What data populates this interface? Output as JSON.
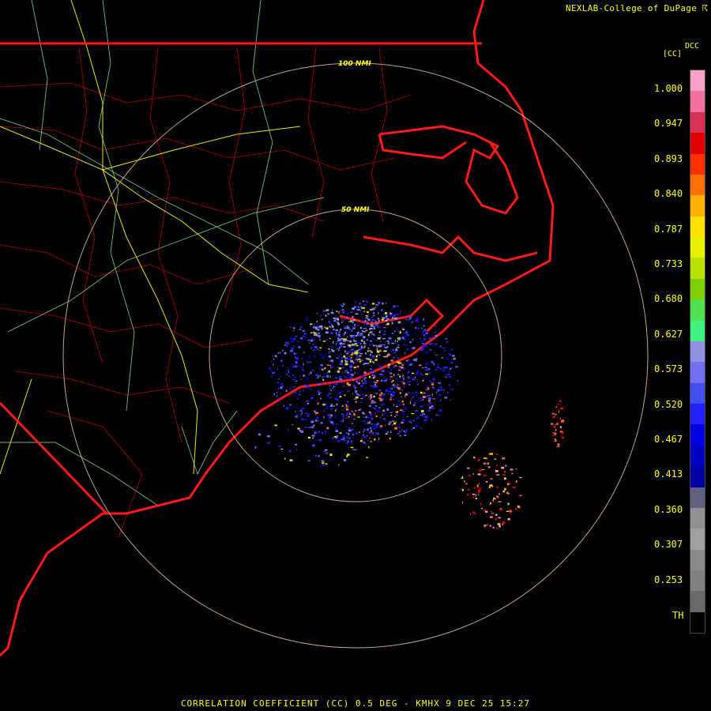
{
  "header": {
    "credit": "NEXLAB-College of DuPage ☈"
  },
  "legend": {
    "title": "DCC",
    "units": "[CC]",
    "bottom_label": "TH",
    "ticks": [
      "1.000",
      "0.947",
      "0.893",
      "0.840",
      "0.787",
      "0.733",
      "0.680",
      "0.627",
      "0.573",
      "0.520",
      "0.467",
      "0.413",
      "0.360",
      "0.307",
      "0.253"
    ],
    "colors": [
      "#f8a0c8",
      "#f070a0",
      "#d83050",
      "#e00000",
      "#ff3000",
      "#ff7000",
      "#ffb000",
      "#ffe000",
      "#e8f000",
      "#b8e000",
      "#80d000",
      "#50e050",
      "#40f080",
      "#9090e0",
      "#7070f0",
      "#4050f0",
      "#2020f8",
      "#0000e0",
      "#0000c0",
      "#0000a0",
      "#606080",
      "#909090",
      "#a0a0a0",
      "#8a8a8a",
      "#808080",
      "#6a6a6a",
      "#000000"
    ]
  },
  "map": {
    "ring_labels": [
      "100 NMI",
      "50 NMI"
    ],
    "colors": {
      "coast": "#ff1a1a",
      "county": "#b00000",
      "highway_green": "#70c070",
      "highway_yellow": "#e8e800",
      "ring": "#c8a080"
    }
  },
  "caption": "CORRELATION COEFFICIENT (CC) 0.5 DEG - KMHX 9 DEC 25 15:27"
}
